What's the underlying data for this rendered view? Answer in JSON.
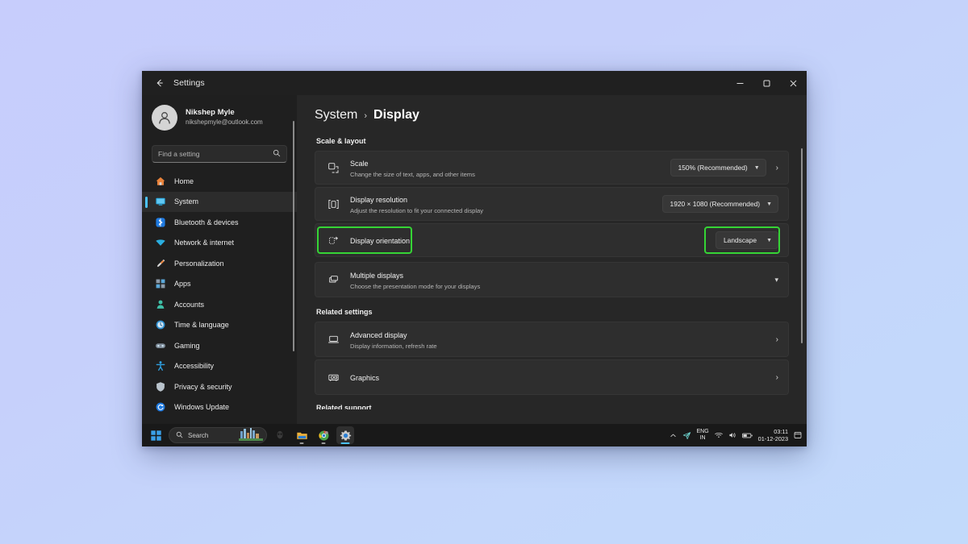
{
  "desktop": {
    "background_top": "#c7cdfc",
    "background_bottom": "#c2dafb"
  },
  "window": {
    "titlebar": {
      "back_label": "←",
      "title": "Settings",
      "minimize": "–",
      "maximize": "▢",
      "close": "✕"
    }
  },
  "sidebar": {
    "profile": {
      "name": "Nikshep Myle",
      "email": "nikshepmyle@outlook.com"
    },
    "search": {
      "placeholder": "Find a setting",
      "icon": "search-icon"
    },
    "items": [
      {
        "label": "Home",
        "icon": "home-icon",
        "active": false
      },
      {
        "label": "System",
        "icon": "system-monitor-icon",
        "active": true
      },
      {
        "label": "Bluetooth & devices",
        "icon": "bluetooth-icon",
        "active": false
      },
      {
        "label": "Network & internet",
        "icon": "wifi-icon",
        "active": false
      },
      {
        "label": "Personalization",
        "icon": "paintbrush-icon",
        "active": false
      },
      {
        "label": "Apps",
        "icon": "apps-grid-icon",
        "active": false
      },
      {
        "label": "Accounts",
        "icon": "account-person-icon",
        "active": false
      },
      {
        "label": "Time & language",
        "icon": "clock-globe-icon",
        "active": false
      },
      {
        "label": "Gaming",
        "icon": "gamepad-icon",
        "active": false
      },
      {
        "label": "Accessibility",
        "icon": "accessibility-person-icon",
        "active": false
      },
      {
        "label": "Privacy & security",
        "icon": "shield-icon",
        "active": false
      },
      {
        "label": "Windows Update",
        "icon": "update-refresh-icon",
        "active": false
      }
    ]
  },
  "main": {
    "breadcrumb": {
      "root": "System",
      "separator": "›",
      "current": "Display"
    },
    "scale_layout": {
      "section_label": "Scale & layout",
      "cards": [
        {
          "title": "Scale",
          "subtitle": "Change the size of text, apps, and other items",
          "icon": "scale-resize-icon",
          "value": "150% (Recommended)",
          "has_dropdown": true,
          "has_chevron_right": true
        },
        {
          "title": "Display resolution",
          "subtitle": "Adjust the resolution to fit your connected display",
          "icon": "resolution-icon",
          "value": "1920 × 1080 (Recommended)",
          "has_dropdown": true,
          "has_chevron_right": false
        },
        {
          "title": "Display orientation",
          "subtitle": "",
          "icon": "orientation-rotate-icon",
          "value": "Landscape",
          "has_dropdown": true,
          "has_chevron_right": false,
          "highlighted": true
        },
        {
          "title": "Multiple displays",
          "subtitle": "Choose the presentation mode for your displays",
          "icon": "multiple-displays-icon",
          "value": "",
          "has_dropdown": false,
          "has_chevron_down": true
        }
      ]
    },
    "related_settings": {
      "section_label": "Related settings",
      "cards": [
        {
          "title": "Advanced display",
          "subtitle": "Display information, refresh rate",
          "icon": "laptop-display-icon",
          "has_chevron_right": true
        },
        {
          "title": "Graphics",
          "subtitle": "",
          "icon": "graphics-card-icon",
          "has_chevron_right": true
        }
      ]
    },
    "cut_off_label": "Related support"
  },
  "annotation": {
    "highlight_color": "#35d435",
    "targets": [
      "display-orientation-label",
      "display-orientation-dropdown"
    ]
  },
  "taskbar": {
    "start": "start-icon",
    "search": {
      "placeholder": "Search",
      "icon": "search-icon"
    },
    "apps": [
      {
        "name": "alienware-icon",
        "active": false,
        "running": false
      },
      {
        "name": "file-explorer-icon",
        "active": false,
        "running": true
      },
      {
        "name": "chrome-icon",
        "active": false,
        "running": true
      },
      {
        "name": "settings-gear-icon",
        "active": true,
        "running": true
      }
    ],
    "tray": {
      "overflow": "chevron-up-icon",
      "send_icon": "telegram-send-icon",
      "language_line1": "ENG",
      "language_line2": "IN",
      "wifi": "wifi-icon",
      "volume": "speaker-icon",
      "battery": "battery-icon",
      "time": "03:11",
      "date": "01-12-2023",
      "notifications": "notification-icon"
    }
  }
}
